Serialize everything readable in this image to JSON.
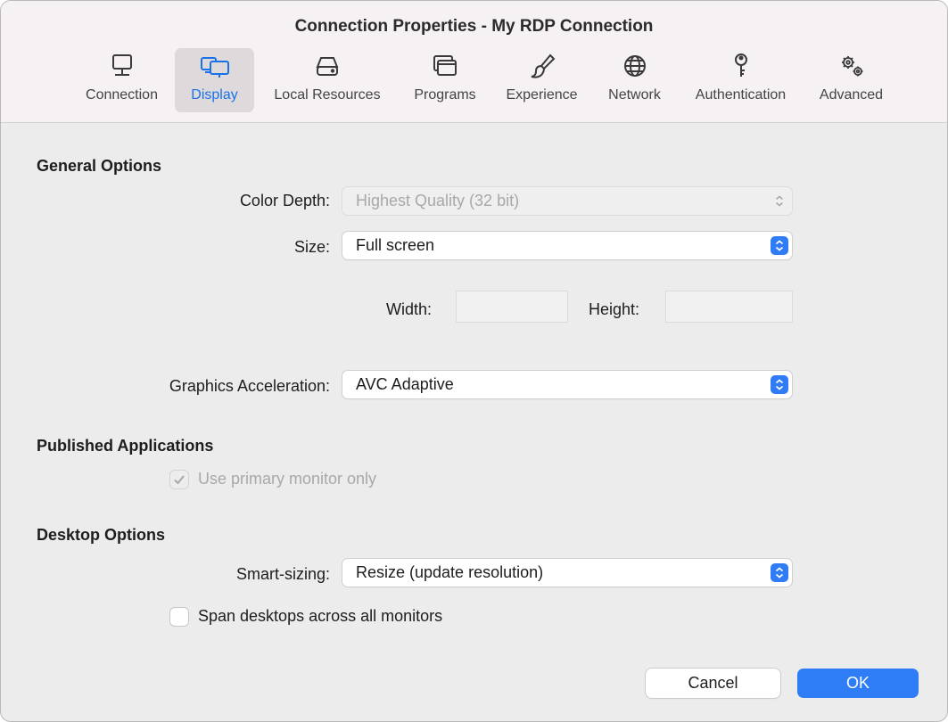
{
  "window": {
    "title": "Connection Properties - My RDP Connection"
  },
  "tabs": [
    {
      "label": "Connection",
      "icon": "monitor-icon"
    },
    {
      "label": "Display",
      "icon": "displays-icon",
      "active": true
    },
    {
      "label": "Local Resources",
      "icon": "drive-icon"
    },
    {
      "label": "Programs",
      "icon": "windows-icon"
    },
    {
      "label": "Experience",
      "icon": "paintbrush-icon"
    },
    {
      "label": "Network",
      "icon": "globe-icon"
    },
    {
      "label": "Authentication",
      "icon": "key-icon"
    },
    {
      "label": "Advanced",
      "icon": "gears-icon"
    }
  ],
  "general": {
    "heading": "General Options",
    "color_depth_label": "Color Depth:",
    "color_depth_value": "Highest Quality (32 bit)",
    "size_label": "Size:",
    "size_value": "Full screen",
    "width_label": "Width:",
    "width_value": "",
    "height_label": "Height:",
    "height_value": "",
    "graphics_label": "Graphics Acceleration:",
    "graphics_value": "AVC Adaptive"
  },
  "published": {
    "heading": "Published Applications",
    "primary_monitor_label": "Use primary monitor only",
    "primary_monitor_checked": true
  },
  "desktop": {
    "heading": "Desktop Options",
    "smart_sizing_label": "Smart-sizing:",
    "smart_sizing_value": "Resize (update resolution)",
    "span_label": "Span desktops across all monitors",
    "span_checked": false
  },
  "buttons": {
    "cancel": "Cancel",
    "ok": "OK"
  },
  "colors": {
    "accent": "#2f7cf6",
    "active_tab_text": "#1b72e8"
  }
}
